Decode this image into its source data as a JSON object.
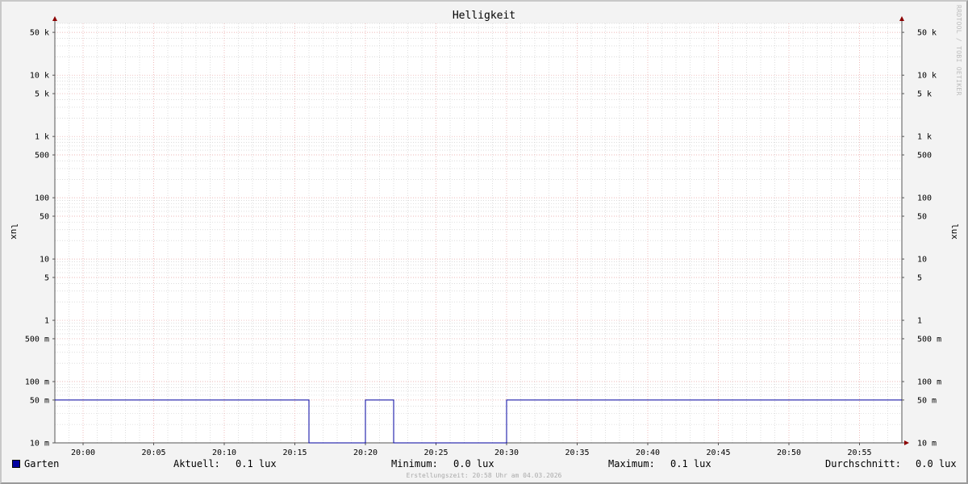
{
  "chart_data": {
    "type": "line",
    "title": "Helligkeit",
    "ylabel": "lux",
    "yscale": "log",
    "ylim": [
      0.01,
      70000
    ],
    "xlim": [
      "19:58",
      "20:58"
    ],
    "x_ticks": [
      "20:00",
      "20:05",
      "20:10",
      "20:15",
      "20:20",
      "20:25",
      "20:30",
      "20:35",
      "20:40",
      "20:45",
      "20:50",
      "20:55"
    ],
    "y_ticks": [
      {
        "label": "50 k",
        "value": 50000
      },
      {
        "label": "10 k",
        "value": 10000
      },
      {
        "label": "5 k",
        "value": 5000
      },
      {
        "label": "1 k",
        "value": 1000
      },
      {
        "label": "500",
        "value": 500
      },
      {
        "label": "100",
        "value": 100
      },
      {
        "label": "50",
        "value": 50
      },
      {
        "label": "10",
        "value": 10
      },
      {
        "label": "5",
        "value": 5
      },
      {
        "label": "1",
        "value": 1
      },
      {
        "label": "500 m",
        "value": 0.5
      },
      {
        "label": "100 m",
        "value": 0.1
      },
      {
        "label": "50 m",
        "value": 0.05
      },
      {
        "label": "10 m",
        "value": 0.01
      }
    ],
    "grid": true,
    "series": [
      {
        "name": "Garten",
        "color": "#0000a0",
        "points": [
          [
            "19:58",
            0.05
          ],
          [
            "20:16",
            0.05
          ],
          [
            "20:16",
            0.01
          ],
          [
            "20:20",
            0.01
          ],
          [
            "20:20",
            0.05
          ],
          [
            "20:22",
            0.05
          ],
          [
            "20:22",
            0.01
          ],
          [
            "20:30",
            0.01
          ],
          [
            "20:30",
            0.05
          ],
          [
            "20:58",
            0.05
          ]
        ]
      }
    ]
  },
  "legend": {
    "series_name": "Garten",
    "current_label": "Aktuell:",
    "current_value": "0.1 lux",
    "minimum_label": "Minimum:",
    "minimum_value": "0.0 lux",
    "maximum_label": "Maximum:",
    "maximum_value": "0.1 lux",
    "average_label": "Durchschnitt:",
    "average_value": "0.0 lux"
  },
  "footer": "Erstellungszeit: 20:58 Uhr am 04.03.2026",
  "credit": "RRDTOOL / TOBI OETIKER",
  "colors": {
    "background": "#f3f3f3",
    "plot_background": "#ffffff",
    "major_grid": "#e8a0a0",
    "minor_grid": "#c8c8c8",
    "axis": "#555555",
    "arrow": "#8b0000",
    "series": "#0000a0"
  }
}
